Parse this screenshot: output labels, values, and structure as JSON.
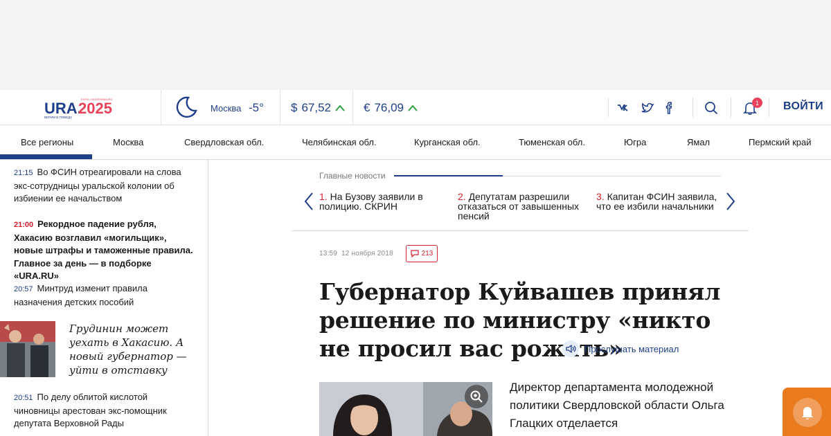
{
  "header": {
    "logo_main": "URA.",
    "logo_year": "2025",
    "logo_small_top": "EXPO | EKATERINBURG",
    "logo_small_bottom": "ВЕРИМ В ПОБЕДУ",
    "weather": {
      "city": "Москва",
      "temp": "-5°",
      "icon": "moon-icon"
    },
    "usd": {
      "symbol": "$",
      "value": "67,52",
      "trend": "up"
    },
    "eur": {
      "symbol": "€",
      "value": "76,09",
      "trend": "up"
    },
    "social": [
      "vk-icon",
      "twitter-icon",
      "facebook-icon"
    ],
    "notifications_count": "1",
    "login_label": "ВОЙТИ"
  },
  "regions": [
    "Все регионы",
    "Москва",
    "Свердловская обл.",
    "Челябинская обл.",
    "Курганская обл.",
    "Тюменская обл.",
    "Югра",
    "Ямал",
    "Пермский край"
  ],
  "feed": [
    {
      "time": "21:15",
      "text": "Во ФСИН отреагировали на слова экс-сотрудницы уральской колонии об избиении ее начальством",
      "bold": false
    },
    {
      "time": "21:00",
      "text": "Рекордное падение рубля, Хакасию возглавил «могильщик», новые штрафы и таможенные правила. Главное за день — в подборке «URA.RU»",
      "bold": true
    },
    {
      "time": "20:57",
      "text": "Минтруд изменит правила назначения детских пособий",
      "bold": false
    },
    {
      "time": "20:51",
      "text": "По делу облитой кислотой чиновницы арестован экс-помощник депутата Верховной Рады",
      "bold": false
    }
  ],
  "feed_feature": "Грудинин может уехать в Хакасию. А новый губернатор — уйти в отставку",
  "main_news": {
    "label": "Главные новости",
    "items": [
      {
        "num": "1.",
        "text": "На Бузову заявили в полицию. СКРИН"
      },
      {
        "num": "2.",
        "text": "Депутатам разрешили отказаться от завышенных пенсий"
      },
      {
        "num": "3.",
        "text": "Капитан ФСИН заявила, что ее избили начальники"
      }
    ]
  },
  "article": {
    "time": "13:59",
    "date": "12 ноября 2018",
    "comments": "213",
    "headline": "Губернатор Куйвашев принял решение по министру «никто не просил вас рожать»",
    "listen_label": "Прослушать материал",
    "lead": "Директор департамента молодежной политики Свердловской области Ольга Глацких отделается"
  },
  "colors": {
    "brand": "#1f3e8a",
    "accent": "#d6202e",
    "push": "#ea7a1e",
    "up": "#2ea043"
  }
}
